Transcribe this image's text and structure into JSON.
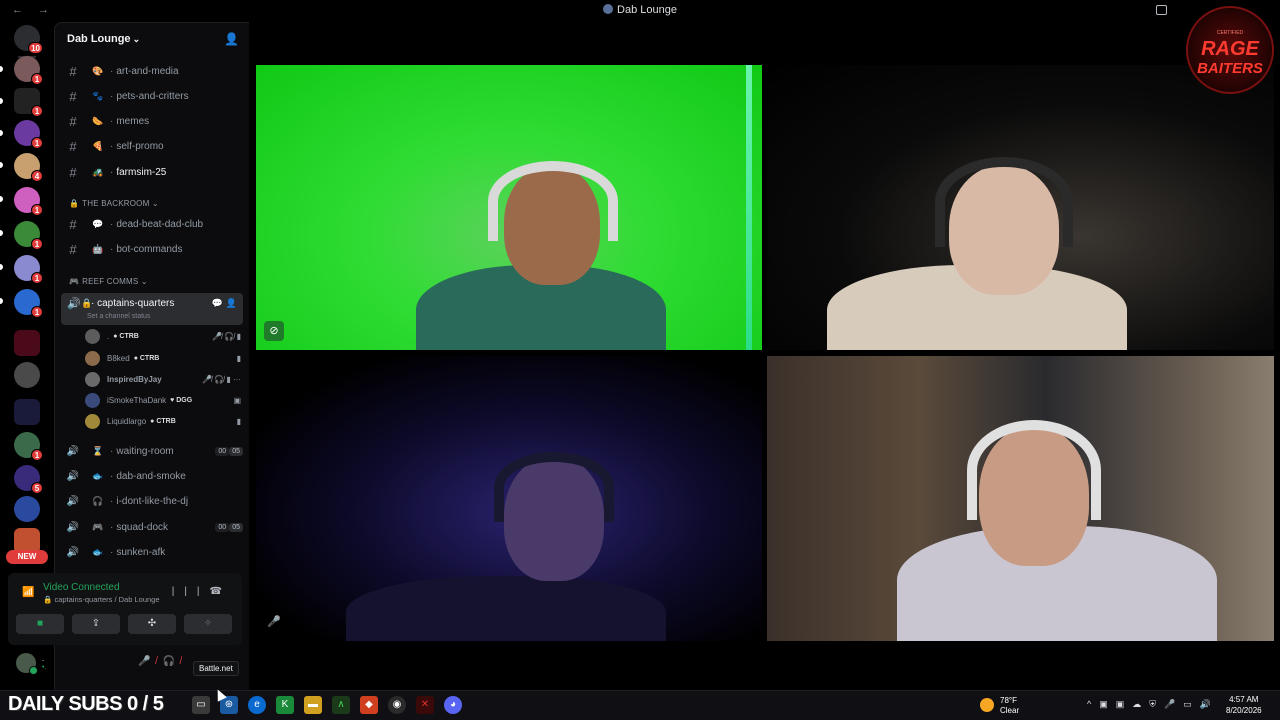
{
  "window": {
    "title": "Dab Lounge"
  },
  "server": {
    "name": "Dab Lounge"
  },
  "guild_badges": [
    "10",
    "1",
    "1",
    "1",
    "4",
    "1",
    "1",
    "1",
    "1",
    "1",
    "5"
  ],
  "rail_new_label": "NEW",
  "text_channels": [
    {
      "emoji": "🎨",
      "name": "art-and-media"
    },
    {
      "emoji": "🐾",
      "name": "pets-and-critters"
    },
    {
      "emoji": "🌭",
      "name": "memes"
    },
    {
      "emoji": "🍕",
      "name": "self-promo"
    },
    {
      "emoji": "🚜",
      "name": "farmsim-25"
    }
  ],
  "categories": {
    "backroom": "THE BACKROOM",
    "reef": "REEF COMMS"
  },
  "backroom_channels": [
    {
      "emoji": "💬",
      "name": "dead-beat-dad-club"
    },
    {
      "emoji": "🤖",
      "name": "bot-commands"
    }
  ],
  "active_voice": {
    "name": "captains-quarters",
    "status_placeholder": "Set a channel status"
  },
  "voice_users": [
    {
      "name": ".",
      "tag": "CTRB",
      "color": "#5c5c5c"
    },
    {
      "name": "B8ked",
      "tag": "CTRB",
      "color": "#8a6a4a"
    },
    {
      "name": "InspiredByJay",
      "tag": "",
      "color": "#6a6a6a"
    },
    {
      "name": "iSmokeThaDank",
      "tag": "DGG",
      "color": "#3a4a7a"
    },
    {
      "name": "Liquidlargo",
      "tag": "CTRB",
      "color": "#a08a3a"
    }
  ],
  "voice_channels": [
    {
      "emoji": "⌛",
      "name": "waiting-room",
      "count_a": "00",
      "count_b": "05"
    },
    {
      "emoji": "🐟",
      "name": "dab-and-smoke",
      "count_a": "",
      "count_b": ""
    },
    {
      "emoji": "🎧",
      "name": "i-dont-like-the-dj",
      "count_a": "",
      "count_b": ""
    },
    {
      "emoji": "🎮",
      "name": "squad-dock",
      "count_a": "00",
      "count_b": "05"
    },
    {
      "emoji": "🐟",
      "name": "sunken-afk",
      "count_a": "",
      "count_b": ""
    }
  ],
  "connection": {
    "status": "Video Connected",
    "location": "captains-quarters / Dab Lounge"
  },
  "user": {
    "name": ".",
    "status": "•."
  },
  "tooltip": "Battle.net",
  "logo": {
    "line1": "RAGE",
    "line2": "BAITERS",
    "small": "CERTIFIED"
  },
  "taskbar": {
    "banner": "DAILY SUBS 0 / 5",
    "weather_temp": "78°F",
    "weather_cond": "Clear",
    "time": "4:57 AM",
    "date": "8/20/2026"
  },
  "colors": {
    "accent_green": "#23a55a",
    "danger_red": "#f23f43",
    "greenscreen": "#2fdc33"
  }
}
